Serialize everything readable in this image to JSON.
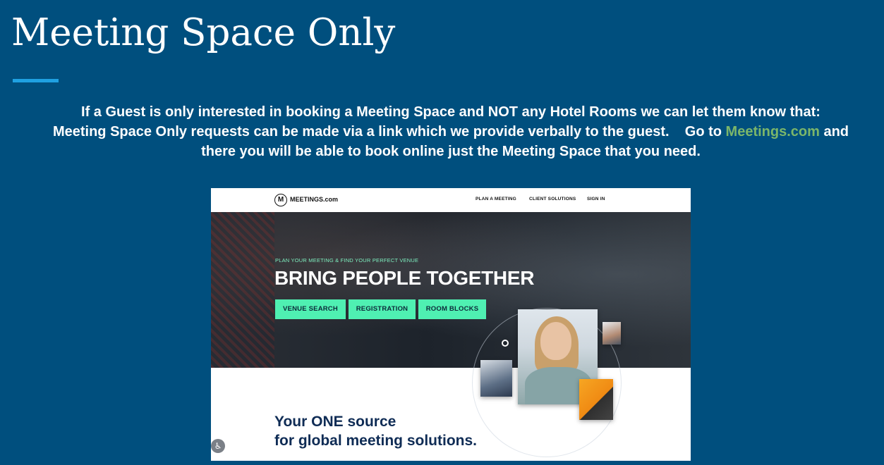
{
  "slide": {
    "title": "Meeting Space Only",
    "body_line1": "If a Guest is only interested in booking a Meeting Space and NOT any Hotel Rooms we can let them know that:",
    "body_line2_pre": "Meeting Space Only requests can be made via a link which we provide verbally to the guest.    Go to ",
    "body_link": "Meetings.com",
    "body_line2_post": " and",
    "body_line3": "there you will be able to book online just the Meeting Space that you need.",
    "accent_color": "#1fa1e2",
    "background_color": "#004f7e",
    "link_color": "#7bb66a"
  },
  "website": {
    "logo_letter": "M",
    "logo_text": "MEETINGS.com",
    "nav": {
      "plan": "PLAN A MEETING",
      "solutions": "CLIENT SOLUTIONS",
      "signin": "SIGN IN"
    },
    "hero": {
      "eyebrow": "PLAN YOUR MEETING & FIND YOUR PERFECT VENUE",
      "headline": "BRING PEOPLE TOGETHER",
      "buttons": {
        "venue_search": "VENUE SEARCH",
        "registration": "REGISTRATION",
        "room_blocks": "ROOM BLOCKS"
      },
      "button_color": "#4ff0b2"
    },
    "tagline": {
      "line1": "Your ONE source",
      "line2": "for global meeting solutions."
    },
    "accessibility_icon": "accessibility-icon"
  }
}
